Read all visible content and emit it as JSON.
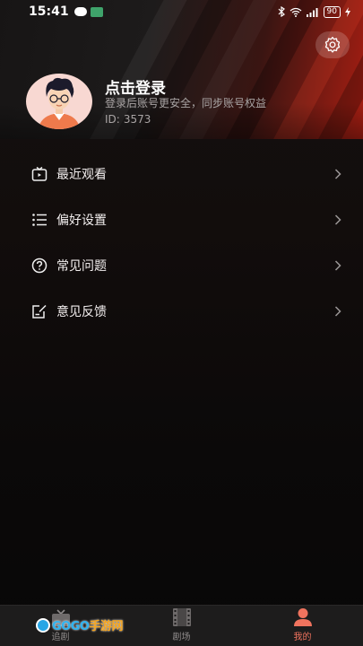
{
  "status_bar": {
    "time": "15:41",
    "battery": "90"
  },
  "profile": {
    "login_title": "点击登录",
    "login_subtitle": "登录后账号更安全，同步账号权益",
    "id_label": "ID:",
    "id_value": "3573"
  },
  "menu": {
    "items": [
      {
        "label": "最近观看",
        "icon": "tv-icon"
      },
      {
        "label": "偏好设置",
        "icon": "list-icon"
      },
      {
        "label": "常见问题",
        "icon": "question-circle-icon"
      },
      {
        "label": "意见反馈",
        "icon": "edit-note-icon"
      }
    ]
  },
  "tabbar": {
    "tabs": [
      {
        "label": "追剧",
        "icon": "tv-icon",
        "active": false
      },
      {
        "label": "剧场",
        "icon": "film-icon",
        "active": false
      },
      {
        "label": "我的",
        "icon": "user-icon",
        "active": true
      }
    ]
  },
  "watermark": {
    "text_blue": "GOGO",
    "text_orange": "手游网"
  },
  "colors": {
    "accent": "#f0735e",
    "banner_red": "#a81e12",
    "background": "#0b0909"
  }
}
